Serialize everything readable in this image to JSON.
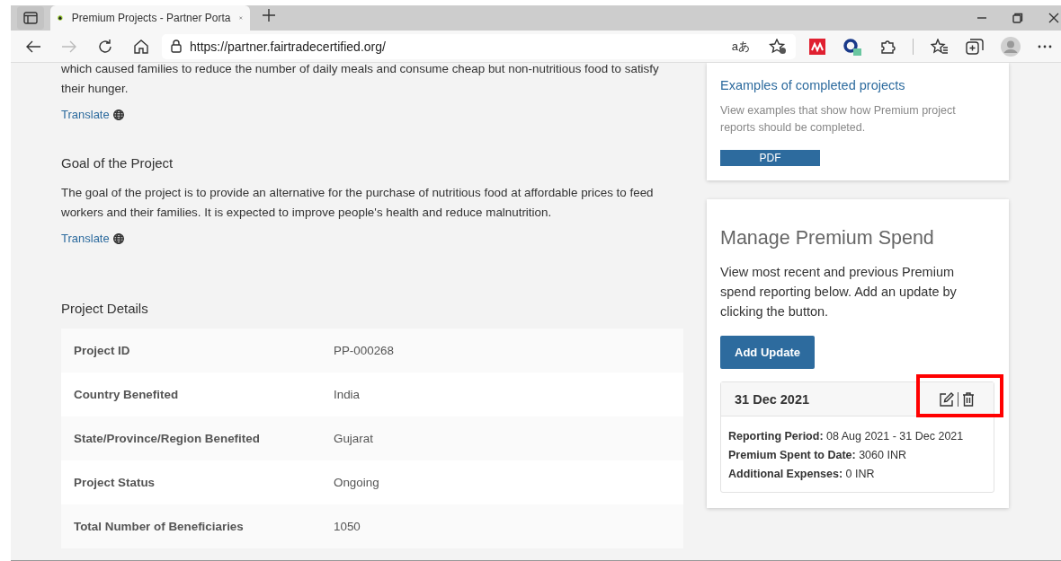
{
  "browser": {
    "tab": {
      "title": "Premium Projects - Partner Porta",
      "selected": true
    },
    "url": "https://partner.fairtradecertified.org/",
    "read_aloud_label": "aあ"
  },
  "main": {
    "intro_text": "which caused families to reduce the number of daily meals and consume cheap but non-nutritious food to satisfy their hunger.",
    "intro_translate": "Translate",
    "goal": {
      "heading": "Goal of the Project",
      "text": "The goal of the project is to provide an alternative for the purchase of nutritious food at affordable prices to feed workers and their families. It is expected to improve people's health and reduce malnutrition.",
      "translate": "Translate"
    },
    "details": {
      "heading": "Project Details",
      "rows": [
        {
          "label": "Project ID",
          "value": "PP-000268"
        },
        {
          "label": "Country Benefited",
          "value": "India"
        },
        {
          "label": "State/Province/Region Benefited",
          "value": "Gujarat"
        },
        {
          "label": "Project Status",
          "value": "Ongoing"
        },
        {
          "label": "Total Number of Beneficiaries",
          "value": "1050"
        }
      ]
    }
  },
  "sidebar": {
    "examples": {
      "title": "Examples of completed projects",
      "text": "View examples that show how Premium project reports should be completed.",
      "button": "PDF"
    },
    "manage": {
      "title": "Manage Premium Spend",
      "text": "View most recent and previous Premium spend reporting below. Add an update by clicking the button.",
      "button": "Add Update",
      "report": {
        "date": "31 Dec 2021",
        "highlighted": true,
        "lines": [
          "**Reporting Period:** 08 Aug 2021 - 31 Dec 2021",
          "**Premium Spent to Date:** 3060 INR",
          "**Additional Expenses:** 0 INR"
        ]
      }
    }
  }
}
